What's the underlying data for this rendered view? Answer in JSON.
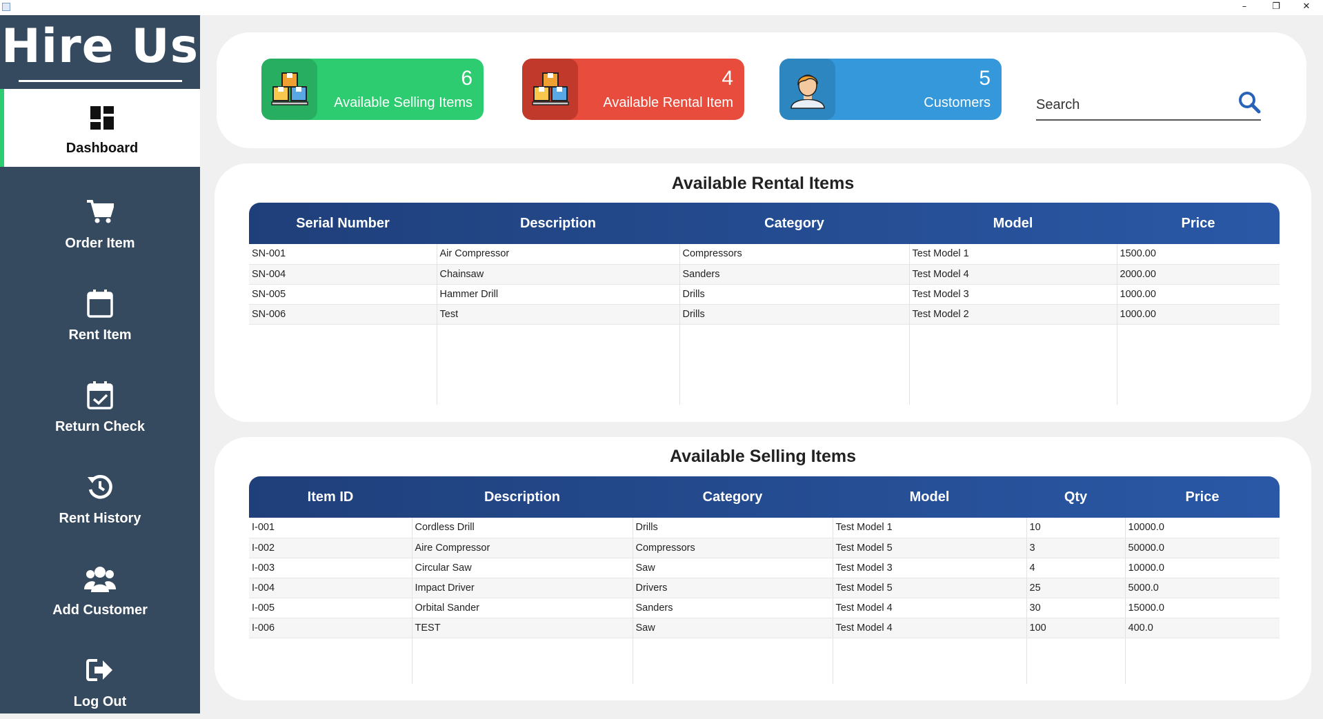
{
  "window": {
    "minimize": "–",
    "restore": "❐",
    "close": "✕"
  },
  "sidebar": {
    "logo": "Hire Us",
    "items": [
      {
        "label": "Dashboard",
        "icon": "dashboard-icon"
      },
      {
        "label": "Order Item",
        "icon": "cart-icon"
      },
      {
        "label": "Rent Item",
        "icon": "calendar-icon"
      },
      {
        "label": "Return Check",
        "icon": "calendar-check-icon"
      },
      {
        "label": "Rent History",
        "icon": "history-icon"
      },
      {
        "label": "Add Customer",
        "icon": "users-icon"
      },
      {
        "label": "Log Out",
        "icon": "logout-icon"
      }
    ]
  },
  "cards": [
    {
      "count": "6",
      "label": "Available Selling Items",
      "color": "#2ecc71",
      "icon_bg": "#27ae60",
      "icon": "boxes-icon"
    },
    {
      "count": "4",
      "label": "Available Rental Item",
      "color": "#e74c3c",
      "icon_bg": "#c0392b",
      "icon": "boxes-icon"
    },
    {
      "count": "5",
      "label": "Customers",
      "color": "#3498db",
      "icon_bg": "#2e86c1",
      "icon": "customer-icon"
    }
  ],
  "search": {
    "placeholder": "Search"
  },
  "rental": {
    "title": "Available Rental Items",
    "columns": [
      "Serial Number",
      "Description",
      "Category",
      "Model",
      "Price"
    ],
    "rows": [
      [
        "SN-001",
        "Air Compressor",
        "Compressors",
        "Test Model 1",
        "1500.00"
      ],
      [
        "SN-004",
        "Chainsaw",
        "Sanders",
        "Test Model 4",
        "2000.00"
      ],
      [
        "SN-005",
        "Hammer Drill",
        "Drills",
        "Test Model 3",
        "1000.00"
      ],
      [
        "SN-006",
        "Test",
        "Drills",
        "Test Model 2",
        "1000.00"
      ]
    ]
  },
  "selling": {
    "title": "Available Selling Items",
    "columns": [
      "Item ID",
      "Description",
      "Category",
      "Model",
      "Qty",
      "Price"
    ],
    "rows": [
      [
        "I-001",
        "Cordless Drill",
        "Drills",
        "Test Model 1",
        "10",
        "10000.0"
      ],
      [
        "I-002",
        "Aire Compressor",
        "Compressors",
        "Test Model 5",
        "3",
        "50000.0"
      ],
      [
        "I-003",
        "Circular Saw",
        "Saw",
        "Test Model 3",
        "4",
        "10000.0"
      ],
      [
        "I-004",
        "Impact Driver",
        "Drivers",
        "Test Model 5",
        "25",
        "5000.0"
      ],
      [
        "I-005",
        "Orbital Sander",
        "Sanders",
        "Test Model 4",
        "30",
        "15000.0"
      ],
      [
        "I-006",
        "TEST",
        "Saw",
        "Test Model 4",
        "100",
        "400.0"
      ]
    ]
  }
}
